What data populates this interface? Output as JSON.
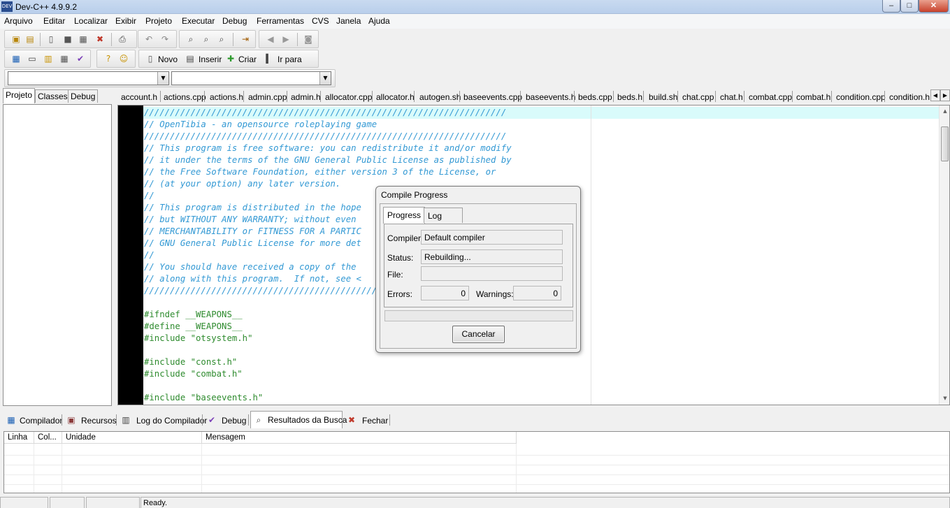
{
  "window": {
    "title": "Dev-C++ 4.9.9.2",
    "app_icon": "DEV",
    "min": "–",
    "max": "□",
    "close": "✕"
  },
  "menu": [
    "Arquivo",
    "Editar",
    "Localizar",
    "Exibir",
    "Projeto",
    "Executar",
    "Debug",
    "Ferramentas",
    "CVS",
    "Janela",
    "Ajuda"
  ],
  "toolbar": {
    "novo": "Novo",
    "inserir": "Inserir",
    "criar": "Criar",
    "ir_para": "Ir para"
  },
  "combo1": {
    "value": ""
  },
  "combo2": {
    "value": ""
  },
  "left_tabs": [
    "Projeto",
    "Classes",
    "Debug"
  ],
  "file_tabs": [
    "account.h",
    "actions.cpp",
    "actions.h",
    "admin.cpp",
    "admin.h",
    "allocator.cpp",
    "allocator.h",
    "autogen.sh",
    "baseevents.cpp",
    "baseevents.h",
    "beds.cpp",
    "beds.h",
    "build.sh",
    "chat.cpp",
    "chat.h",
    "combat.cpp",
    "combat.h",
    "condition.cpp",
    "condition.h"
  ],
  "code_lines": [
    "//////////////////////////////////////////////////////////////////////",
    "// OpenTibia - an opensource roleplaying game",
    "//////////////////////////////////////////////////////////////////////",
    "// This program is free software: you can redistribute it and/or modify",
    "// it under the terms of the GNU General Public License as published by",
    "// the Free Software Foundation, either version 3 of the License, or",
    "// (at your option) any later version.",
    "//",
    "// This program is distributed in the hope",
    "// but WITHOUT ANY WARRANTY; without even",
    "// MERCHANTABILITY or FITNESS FOR A PARTIC",
    "// GNU General Public License for more det",
    "//",
    "// You should have received a copy of the",
    "// along with this program.  If not, see <",
    "//////////////////////////////////////////////////",
    "",
    "#ifndef __WEAPONS__",
    "#define __WEAPONS__",
    "#include \"otsystem.h\"",
    "",
    "#include \"const.h\"",
    "#include \"combat.h\"",
    "",
    "#include \"baseevents.h\""
  ],
  "dialog": {
    "title": "Compile Progress",
    "tabs": [
      "Progress",
      "Log"
    ],
    "compiler_label": "Compiler:",
    "compiler_value": "Default compiler",
    "status_label": "Status:",
    "status_value": "Rebuilding...",
    "file_label": "File:",
    "file_value": "",
    "errors_label": "Errors:",
    "errors_value": "0",
    "warnings_label": "Warnings:",
    "warnings_value": "0",
    "progress": 0,
    "cancel": "Cancelar"
  },
  "bottom_tabs": [
    "Compilador",
    "Recursos",
    "Log do Compilador",
    "Debug",
    "Resultados da Busca",
    "Fechar"
  ],
  "table_headers": [
    "Linha",
    "Col...",
    "Unidade",
    "Mensagem"
  ],
  "status": {
    "text": "Ready."
  },
  "colors": {
    "comment": "#3399d4",
    "preprocessor": "#2e8b2e",
    "current_line": "#d9fbfb",
    "gutter": "#000000"
  }
}
